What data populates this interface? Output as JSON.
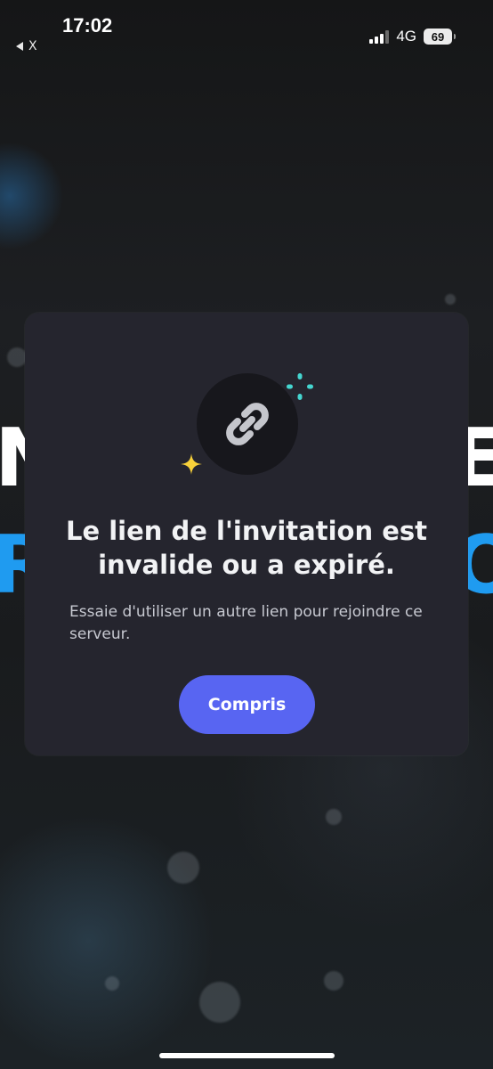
{
  "status_bar": {
    "time": "17:02",
    "back_label": "X",
    "network": "4G",
    "battery": "69"
  },
  "modal": {
    "icon": "link-icon",
    "title": "Le lien de l'invitation est invalide ou a expiré.",
    "description": "Essaie d'utiliser un autre lien pour rejoindre ce serveur.",
    "button_label": "Compris"
  },
  "colors": {
    "modal_background": "#25252e",
    "primary_button": "#5865f2",
    "sparkle_yellow": "#f8d13a",
    "sparkle_teal": "#45d6d0",
    "text_primary": "#f2f3f5",
    "text_secondary": "#c7c9d1"
  }
}
